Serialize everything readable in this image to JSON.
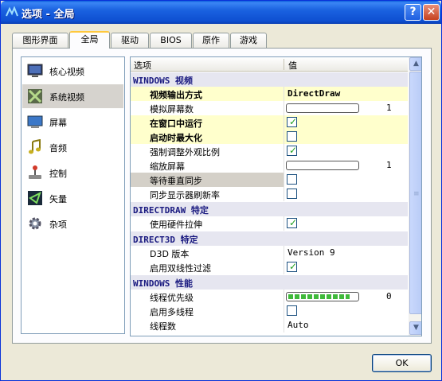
{
  "window": {
    "title": "选项 - 全局",
    "help": "?",
    "close": "✕"
  },
  "tabs": [
    "图形界面",
    "全局",
    "驱动",
    "BIOS",
    "原作",
    "游戏"
  ],
  "sidebar": [
    {
      "label": "核心视频",
      "icon": "monitor-icon"
    },
    {
      "label": "系统视频",
      "icon": "system-video-icon"
    },
    {
      "label": "屏幕",
      "icon": "screen-icon"
    },
    {
      "label": "音频",
      "icon": "music-note-icon"
    },
    {
      "label": "控制",
      "icon": "joystick-icon"
    },
    {
      "label": "矢量",
      "icon": "vector-icon"
    },
    {
      "label": "杂项",
      "icon": "gear-icon"
    }
  ],
  "grid": {
    "col_name": "选项",
    "col_value": "值",
    "sections": {
      "video": "WINDOWS 视频",
      "directdraw": "DIRECTDRAW 特定",
      "direct3d": "DIRECT3D 特定",
      "perf": "WINDOWS 性能"
    },
    "rows": {
      "output": {
        "name": "视频输出方式",
        "value": "DirectDraw"
      },
      "screens": {
        "name": "模拟屏幕数",
        "value": "1"
      },
      "windowed": {
        "name": "在窗口中运行",
        "checked": true
      },
      "maximize": {
        "name": "启动时最大化",
        "checked": false
      },
      "keepaspect": {
        "name": "强制调整外观比例",
        "checked": true
      },
      "prescale": {
        "name": "缩放屏幕",
        "value": "1"
      },
      "waitvsync": {
        "name": "等待垂直同步",
        "checked": false
      },
      "syncrefresh": {
        "name": "同步显示器刷新率",
        "checked": false
      },
      "hwstretch": {
        "name": "使用硬件拉伸",
        "checked": true
      },
      "d3dver": {
        "name": "D3D 版本",
        "value": "Version 9"
      },
      "filter": {
        "name": "启用双线性过滤",
        "checked": true
      },
      "priority": {
        "name": "线程优先级",
        "value": "0",
        "fill": 0.9
      },
      "multithread": {
        "name": "启用多线程",
        "checked": false
      },
      "numthreads": {
        "name": "线程数",
        "value": "Auto"
      }
    }
  },
  "ok_label": "OK",
  "colors": {
    "section_text": "#1a1a80",
    "highlight": "#ffffcc",
    "titlebar": "#0e4fd1"
  }
}
